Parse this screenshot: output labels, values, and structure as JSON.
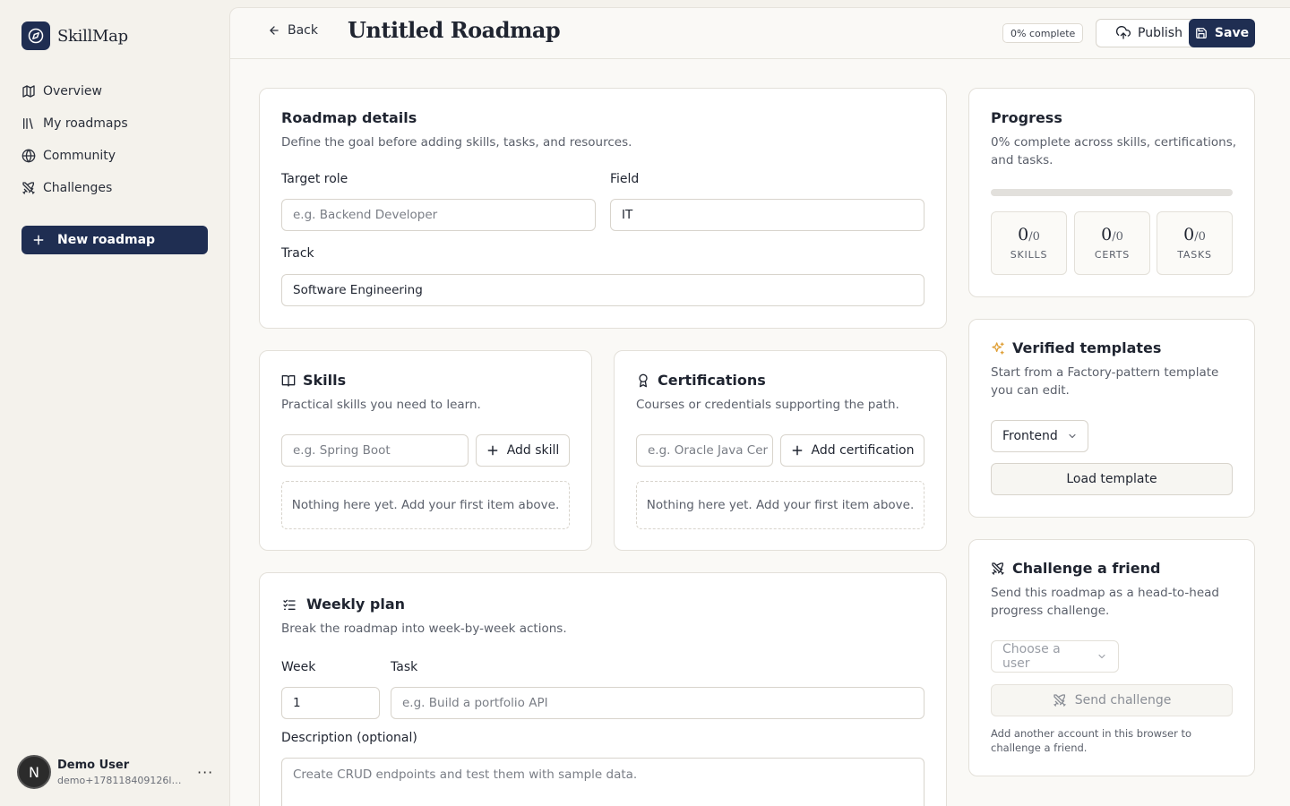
{
  "brand": {
    "name": "SkillMap"
  },
  "nav": {
    "items": [
      {
        "label": "Overview",
        "icon": "map-icon"
      },
      {
        "label": "My roadmaps",
        "icon": "library-icon"
      },
      {
        "label": "Community",
        "icon": "globe-icon"
      },
      {
        "label": "Challenges",
        "icon": "swords-icon"
      }
    ],
    "new_roadmap": "New roadmap"
  },
  "user": {
    "name": "Demo User",
    "email": "demo+178118409126l@s...",
    "initial": "N",
    "more": "···"
  },
  "header": {
    "back": "Back",
    "title": "Untitled Roadmap",
    "percent_badge": "0% complete",
    "publish": "Publish",
    "save": "Save"
  },
  "details": {
    "title": "Roadmap details",
    "subtitle": "Define the goal before adding skills, tasks, and resources.",
    "target_role_label": "Target role",
    "target_role_placeholder": "e.g. Backend Developer",
    "field_label": "Field",
    "field_value": "IT",
    "track_label": "Track",
    "track_value": "Software Engineering"
  },
  "skills": {
    "title": "Skills",
    "subtitle": "Practical skills you need to learn.",
    "placeholder": "e.g. Spring Boot",
    "add": "Add skill",
    "empty": "Nothing here yet. Add your first item above."
  },
  "certs": {
    "title": "Certifications",
    "subtitle": "Courses or credentials supporting the path.",
    "placeholder": "e.g. Oracle Java Cer",
    "add": "Add certification",
    "empty": "Nothing here yet. Add your first item above."
  },
  "weekly": {
    "title": "Weekly plan",
    "subtitle": "Break the roadmap into week-by-week actions.",
    "week_label": "Week",
    "week_value": "1",
    "task_label": "Task",
    "task_placeholder": "e.g. Build a portfolio API",
    "desc_label": "Description (optional)",
    "desc_placeholder": "Create CRUD endpoints and test them with sample data."
  },
  "progress": {
    "title": "Progress",
    "subtitle": "0% complete across skills, certifications, and tasks.",
    "percent": 0,
    "stats": [
      {
        "value": "0",
        "total": "/0",
        "label": "SKILLS"
      },
      {
        "value": "0",
        "total": "/0",
        "label": "CERTS"
      },
      {
        "value": "0",
        "total": "/0",
        "label": "TASKS"
      }
    ]
  },
  "templates": {
    "title": "Verified templates",
    "subtitle": "Start from a Factory-pattern template you can edit.",
    "selected": "Frontend",
    "load": "Load template"
  },
  "challenge": {
    "title": "Challenge a friend",
    "subtitle": "Send this roadmap as a head-to-head progress challenge.",
    "choose_user": "Choose a user",
    "send": "Send challenge",
    "note": "Add another account in this browser to challenge a friend."
  },
  "colors": {
    "accent": "#1f2e52",
    "background": "#f4f2ec",
    "card": "#ffffff",
    "progress_track": "#e2e0dc"
  }
}
